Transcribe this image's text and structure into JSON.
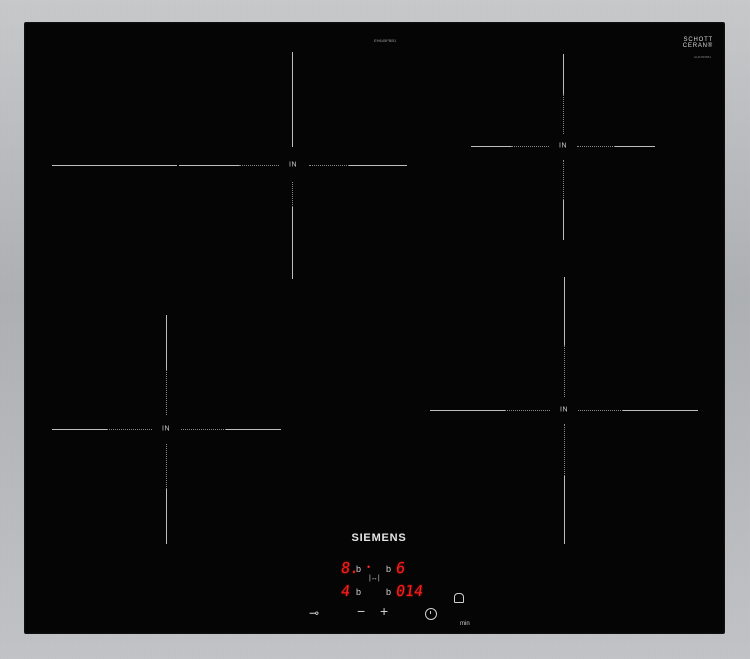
{
  "appliance": {
    "brand": "SIEMENS",
    "model_code": "EH645FBB1",
    "glass_maker": "SCHOTT\nCERAN®",
    "glass_sub": "EH645FBB1"
  },
  "zones": [
    {
      "id": "top-left",
      "label": "IN"
    },
    {
      "id": "top-right",
      "label": "IN"
    },
    {
      "id": "bottom-left",
      "label": "IN"
    },
    {
      "id": "bottom-right",
      "label": "IN"
    }
  ],
  "control_panel": {
    "left_top_digit": "8.",
    "left_top_letter": "b",
    "right_top_letter": "b",
    "right_top_digit": "6",
    "left_bottom_digit": "4",
    "left_bottom_letter": "b",
    "right_bottom_letter": "b",
    "timer_digits": "014",
    "timer_unit": "min",
    "minus_label": "−",
    "plus_label": "+",
    "lock_label": "⊸",
    "range_label": "|↔|",
    "dot_label": "•"
  },
  "colors": {
    "glass": "#050505",
    "frame": "#b9bcbf",
    "display": "#ff1a1a",
    "marking": "#bdbdbd"
  },
  "icons": [
    "bell-icon",
    "timer-icon",
    "child-lock-icon",
    "minus-icon",
    "plus-icon"
  ]
}
